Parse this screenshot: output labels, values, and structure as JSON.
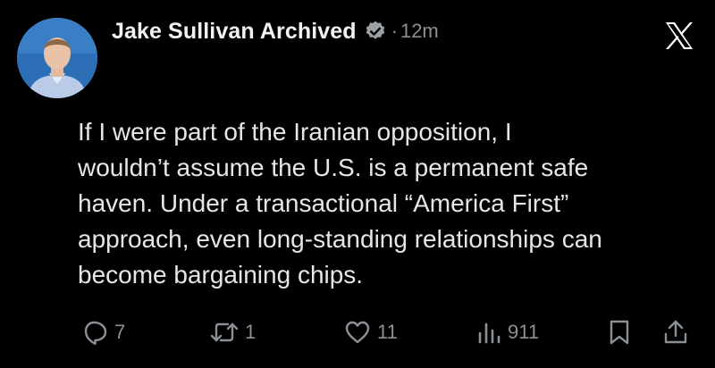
{
  "author": {
    "name": "Jake Sullivan Archived",
    "separator": "·",
    "time": "12m"
  },
  "tweet": {
    "lines": [
      "If I were part of the Iranian opposition, I",
      "wouldn’t assume the U.S. is a permanent safe",
      "haven. Under a transactional “America First”",
      "approach, even long-standing relationships can",
      "become bargaining chips."
    ]
  },
  "actions": {
    "replies": "7",
    "reposts": "1",
    "likes": "11",
    "views": "911"
  },
  "icons": {
    "verified": "verified-badge-icon",
    "brand": "x-logo-icon",
    "reply": "reply-icon",
    "repost": "repost-icon",
    "like": "heart-icon",
    "views": "views-icon",
    "bookmark": "bookmark-icon",
    "share": "share-icon"
  },
  "colors": {
    "background": "#000000",
    "text": "#e7e9ea",
    "muted": "#8b9096",
    "avatar_bg": "#2d6fb7"
  }
}
